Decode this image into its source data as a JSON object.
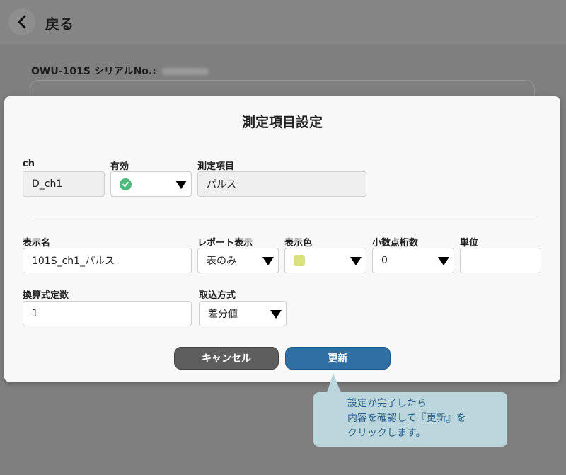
{
  "header": {
    "back_label": "戻る"
  },
  "background": {
    "serial_label": "OWU-101S シリアルNo.:"
  },
  "modal": {
    "title": "測定項目設定",
    "ch": {
      "label": "ch",
      "value": "D_ch1"
    },
    "enabled": {
      "label": "有効",
      "icon": "check-circle-icon"
    },
    "measure_item": {
      "label": "測定項目",
      "value": "パルス"
    },
    "display_name": {
      "label": "表示名",
      "value": "101S_ch1_パルス"
    },
    "report_display": {
      "label": "レポート表示",
      "value": "表のみ"
    },
    "display_color": {
      "label": "表示色",
      "color": "#d9e07e"
    },
    "decimal_places": {
      "label": "小数点桁数",
      "value": "0"
    },
    "unit": {
      "label": "単位",
      "value": ""
    },
    "conversion_factor": {
      "label": "換算式定数",
      "value": "1"
    },
    "capture_method": {
      "label": "取込方式",
      "value": "差分値"
    },
    "cancel_label": "キャンセル",
    "update_label": "更新"
  },
  "tooltip": {
    "lines": [
      "設定が完了したら",
      "内容を確認して『更新』を",
      "クリックします。"
    ]
  },
  "colors": {
    "update": "#2f6fa3",
    "cancel": "#5e5e5e",
    "check": "#4dbb7c",
    "tooltip_bg": "#bcd6de"
  }
}
